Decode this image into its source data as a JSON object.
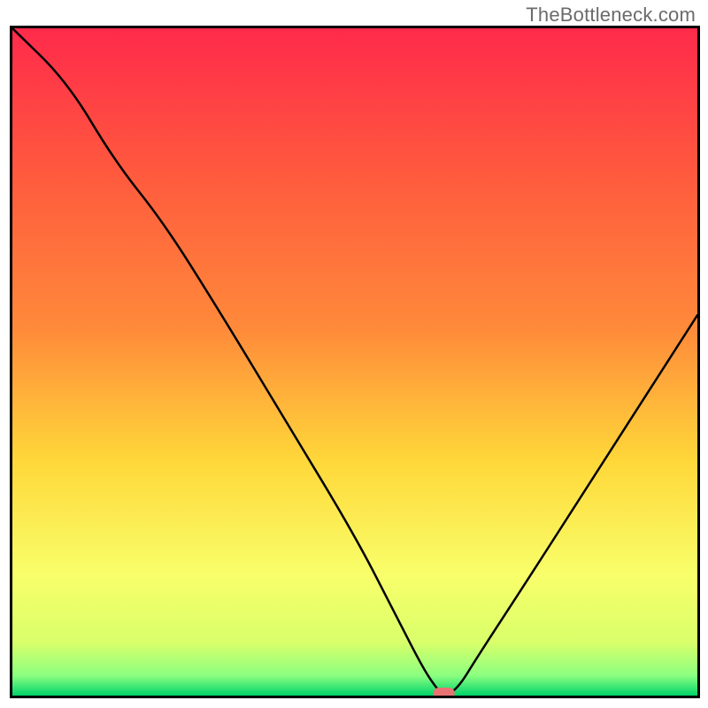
{
  "attribution": "TheBottleneck.com",
  "chart_data": {
    "type": "line",
    "title": "",
    "xlabel": "",
    "ylabel": "",
    "ylim": [
      0,
      100
    ],
    "xlim": [
      0,
      100
    ],
    "background_gradient": {
      "top": "#ff2a4b",
      "mid_top": "#ff8a3a",
      "mid": "#ffd83a",
      "mid_bottom": "#f8ff6a",
      "bottom": "#00d36b"
    },
    "curve": {
      "description": "V-shaped bottleneck curve descending from top-left, reaching minimum around x≈63% then rising toward upper-right",
      "x": [
        0,
        8,
        15,
        22,
        30,
        40,
        50,
        56,
        60,
        62,
        63,
        65,
        68,
        75,
        85,
        95,
        100
      ],
      "y": [
        100,
        92,
        80,
        71,
        58,
        41,
        24,
        12,
        4,
        1,
        0,
        1,
        6,
        17,
        33,
        49,
        57
      ]
    },
    "marker": {
      "x": 63,
      "y": 0,
      "color": "#e97373",
      "label": "optimal-point"
    }
  },
  "colors": {
    "frame": "#000000",
    "curve": "#000000",
    "marker_fill": "#e97373"
  }
}
